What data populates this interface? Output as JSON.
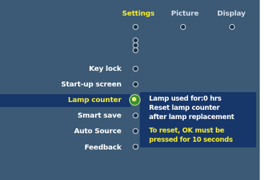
{
  "tabs": [
    {
      "label": "Settings",
      "active": true
    },
    {
      "label": "Picture",
      "active": false
    },
    {
      "label": "Display",
      "active": false
    }
  ],
  "menu": {
    "items": [
      {
        "label": "Key lock"
      },
      {
        "label": "Start-up screen"
      },
      {
        "label": "Lamp counter",
        "selected": true
      },
      {
        "label": "Smart save"
      },
      {
        "label": "Auto Source"
      },
      {
        "label": "Feedback"
      }
    ]
  },
  "info": {
    "line1": "Lamp used for:0 hrs",
    "line2": "Reset lamp counter",
    "line3": "after lamp replacement",
    "warning1": "To reset, OK must be",
    "warning2": "pressed for 10 seconds"
  },
  "colors": {
    "background": "#3c5a75",
    "highlight": "#173669",
    "active_text": "#f3ea33",
    "text": "#ffffff",
    "selected_indicator": "#3a8f28"
  }
}
